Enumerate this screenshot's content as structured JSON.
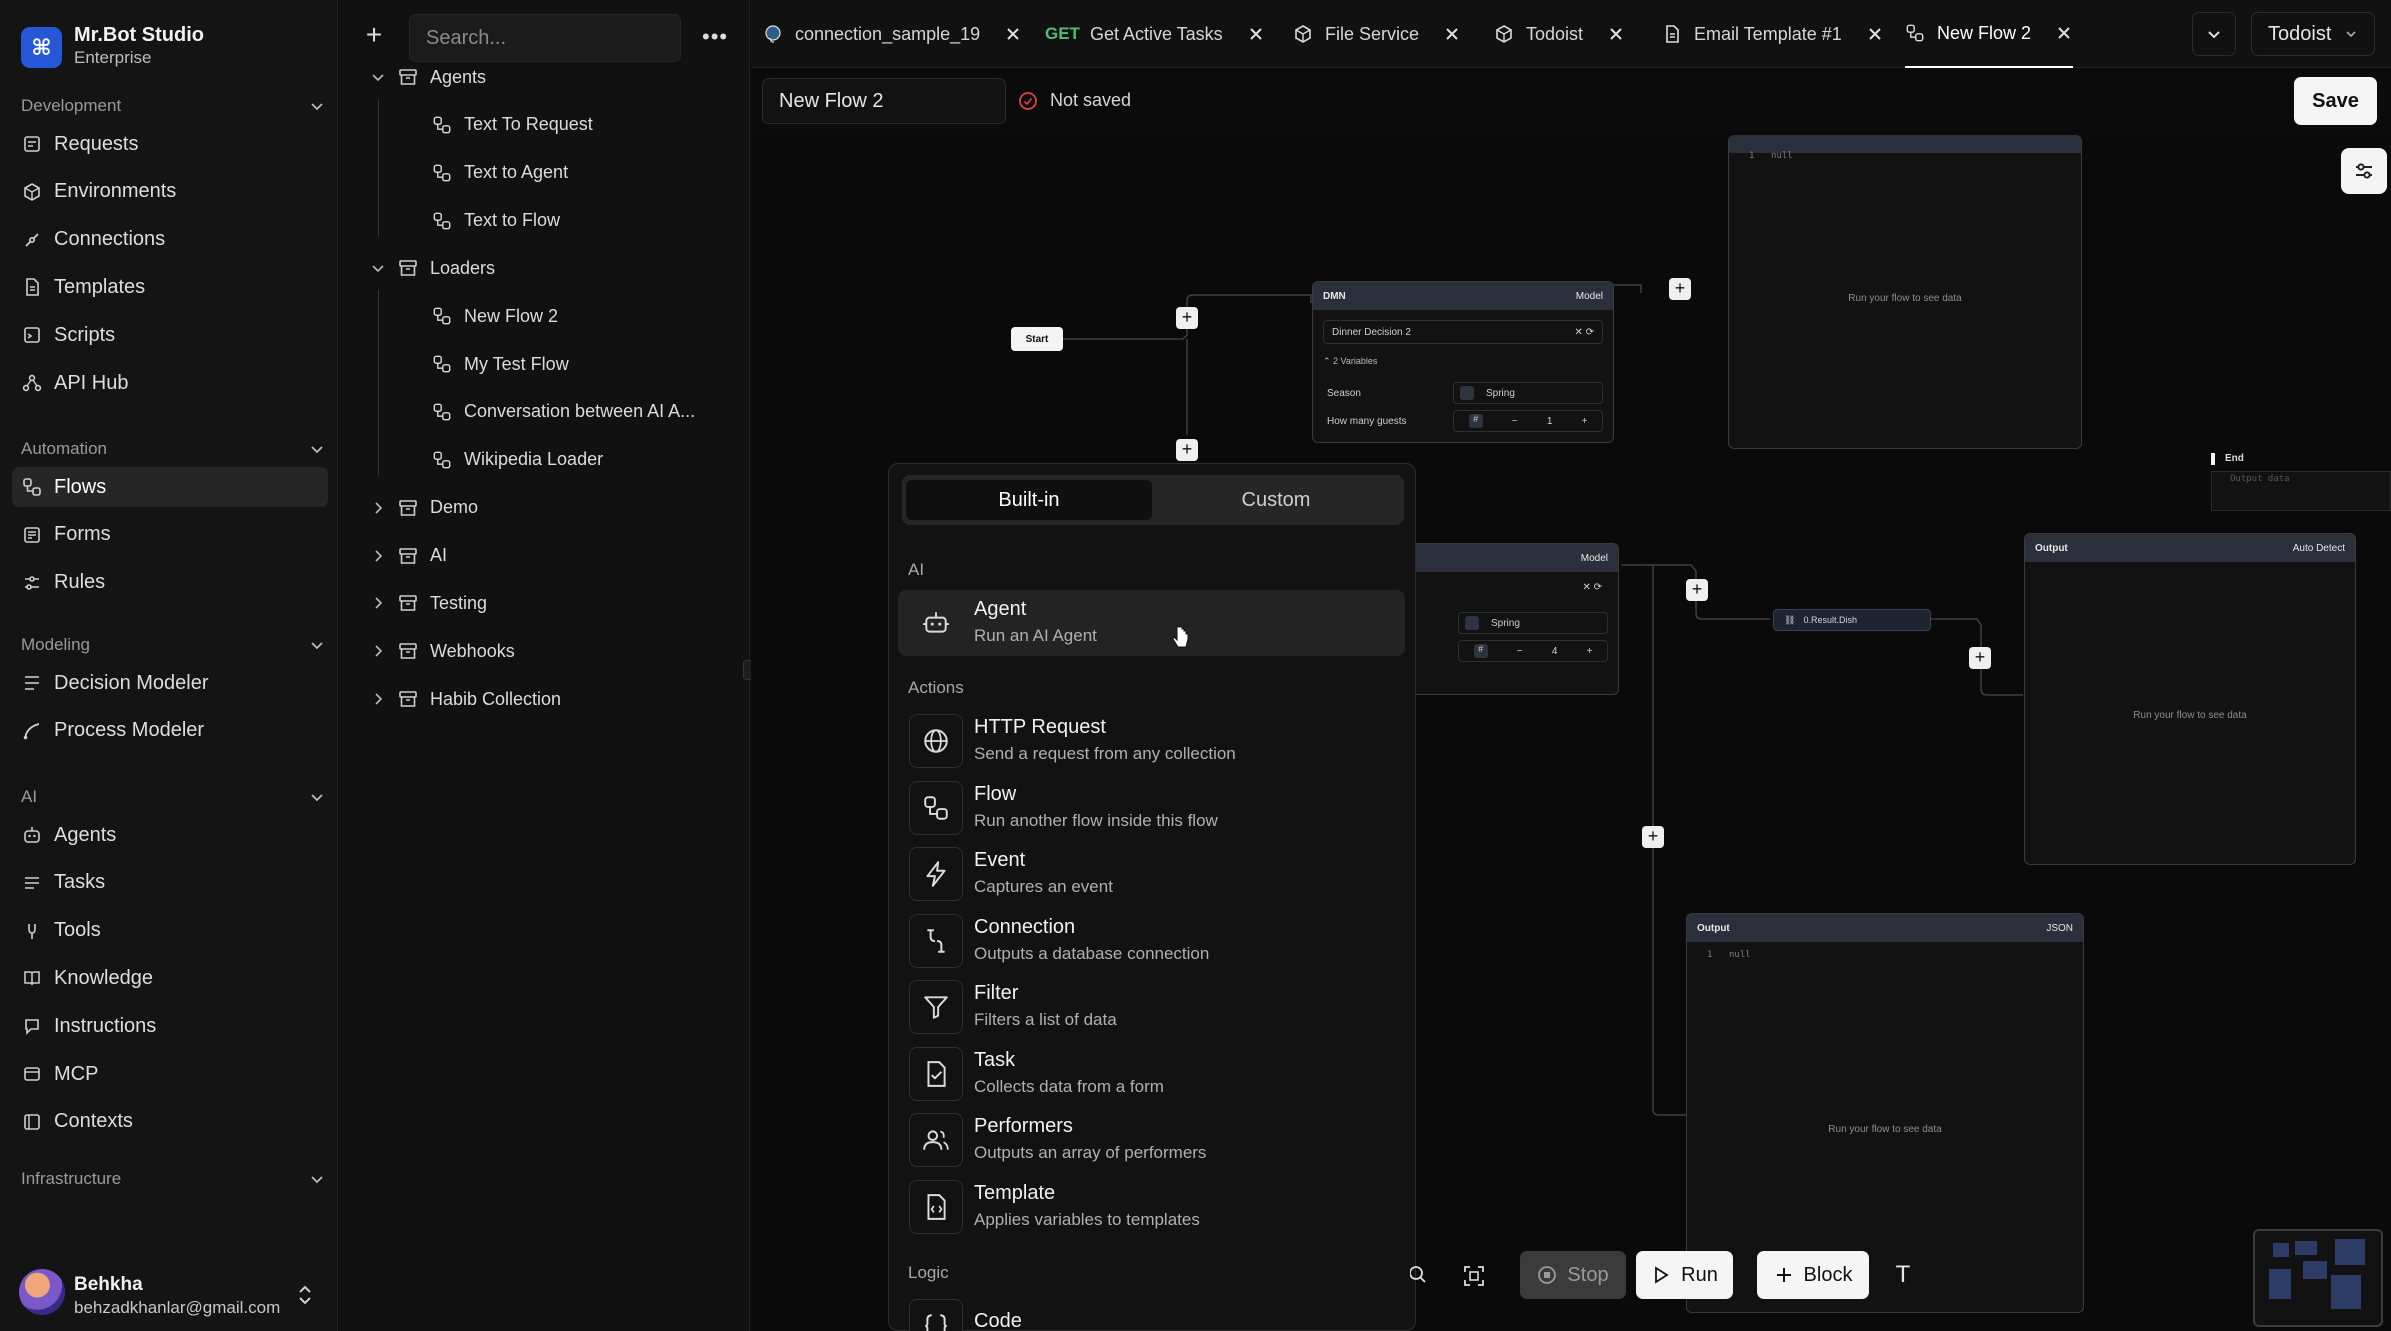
{
  "app": {
    "name": "Mr.Bot Studio",
    "plan": "Enterprise",
    "logo_glyph": "⌘"
  },
  "sidebar": {
    "sections": [
      {
        "title": "Development",
        "items": [
          {
            "label": "Requests",
            "icon": "requests-icon"
          },
          {
            "label": "Environments",
            "icon": "environments-icon"
          },
          {
            "label": "Connections",
            "icon": "connections-icon"
          },
          {
            "label": "Templates",
            "icon": "templates-icon"
          },
          {
            "label": "Scripts",
            "icon": "scripts-icon"
          },
          {
            "label": "API Hub",
            "icon": "api-hub-icon"
          }
        ]
      },
      {
        "title": "Automation",
        "items": [
          {
            "label": "Flows",
            "icon": "flows-icon",
            "active": true
          },
          {
            "label": "Forms",
            "icon": "forms-icon"
          },
          {
            "label": "Rules",
            "icon": "rules-icon"
          }
        ]
      },
      {
        "title": "Modeling",
        "items": [
          {
            "label": "Decision Modeler",
            "icon": "decision-icon"
          },
          {
            "label": "Process Modeler",
            "icon": "process-icon"
          }
        ]
      },
      {
        "title": "AI",
        "items": [
          {
            "label": "Agents",
            "icon": "agents-icon"
          },
          {
            "label": "Tasks",
            "icon": "tasks-icon"
          },
          {
            "label": "Tools",
            "icon": "tools-icon"
          },
          {
            "label": "Knowledge",
            "icon": "knowledge-icon"
          },
          {
            "label": "Instructions",
            "icon": "instructions-icon"
          },
          {
            "label": "MCP",
            "icon": "mcp-icon"
          },
          {
            "label": "Contexts",
            "icon": "contexts-icon"
          }
        ]
      },
      {
        "title": "Infrastructure",
        "items": []
      }
    ],
    "user": {
      "name": "Behkha",
      "email": "behzadkhanlar@gmail.com"
    }
  },
  "tree": {
    "search_placeholder": "Search...",
    "folders": [
      {
        "label": "Agents",
        "expanded": true,
        "children": [
          "Text To Request",
          "Text to Agent",
          "Text to Flow"
        ]
      },
      {
        "label": "Loaders",
        "expanded": true,
        "children": [
          "New Flow 2",
          "My Test Flow",
          "Conversation between AI A...",
          "Wikipedia Loader"
        ]
      },
      {
        "label": "Demo",
        "expanded": false,
        "children": []
      },
      {
        "label": "AI",
        "expanded": false,
        "children": []
      },
      {
        "label": "Testing",
        "expanded": false,
        "children": []
      },
      {
        "label": "Webhooks",
        "expanded": false,
        "children": []
      },
      {
        "label": "Habib Collection",
        "expanded": false,
        "children": []
      }
    ]
  },
  "tabs": [
    {
      "label": "connection_sample_19",
      "icon": "postgres-icon"
    },
    {
      "label": "Get Active Tasks",
      "method": "GET"
    },
    {
      "label": "File Service",
      "icon": "cube-icon"
    },
    {
      "label": "Todoist",
      "icon": "cube-icon"
    },
    {
      "label": "Email Template #1",
      "icon": "document-icon"
    },
    {
      "label": "New Flow 2",
      "icon": "flow-icon",
      "active": true
    }
  ],
  "workspace": "Todoist",
  "flow": {
    "name": "New Flow 2",
    "status": "Not saved",
    "save_label": "Save"
  },
  "canvas": {
    "start_label": "Start",
    "end_label": "End",
    "dmn_node": {
      "type": "DMN",
      "tag": "Model",
      "decision": "Dinner Decision 2",
      "variables_label": "2 Variables",
      "rows": [
        {
          "name": "Season",
          "value": "Spring"
        },
        {
          "name": "How many guests",
          "value": "1"
        }
      ]
    },
    "dmn_node_2": {
      "tag": "Model",
      "season_value": "Spring",
      "guests_value": "4"
    },
    "path_chip": "0.Result.Dish",
    "output_nodes": [
      {
        "title": "Output",
        "tag": "Auto Detect",
        "message": "Run your flow to see data"
      },
      {
        "title": "Output",
        "tag": "JSON",
        "message": "Run your flow to see data",
        "code": "null"
      }
    ],
    "top_output": {
      "code": "null",
      "message": "Run your flow to see data"
    },
    "end_code": "Output data"
  },
  "block_picker": {
    "tabs": [
      "Built-in",
      "Custom"
    ],
    "groups": [
      {
        "title": "AI",
        "items": [
          {
            "title": "Agent",
            "subtitle": "Run an AI Agent",
            "icon": "robot-icon"
          }
        ]
      },
      {
        "title": "Actions",
        "items": [
          {
            "title": "HTTP Request",
            "subtitle": "Send a request from any collection",
            "icon": "globe-icon"
          },
          {
            "title": "Flow",
            "subtitle": "Run another flow inside this flow",
            "icon": "flow-icon"
          },
          {
            "title": "Event",
            "subtitle": "Captures an event",
            "icon": "lightning-icon"
          },
          {
            "title": "Connection",
            "subtitle": "Outputs a database connection",
            "icon": "plug-icon"
          },
          {
            "title": "Filter",
            "subtitle": "Filters a list of data",
            "icon": "filter-icon"
          },
          {
            "title": "Task",
            "subtitle": "Collects data from a form",
            "icon": "task-icon"
          },
          {
            "title": "Performers",
            "subtitle": "Outputs an array of performers",
            "icon": "users-icon"
          },
          {
            "title": "Template",
            "subtitle": "Applies variables to templates",
            "icon": "template-icon"
          }
        ]
      },
      {
        "title": "Logic",
        "items": [
          {
            "title": "Code",
            "subtitle": "",
            "icon": "code-icon"
          }
        ]
      }
    ]
  },
  "toolbar": {
    "stop_label": "Stop",
    "run_label": "Run",
    "block_label": "Block",
    "text_tool": "T"
  }
}
